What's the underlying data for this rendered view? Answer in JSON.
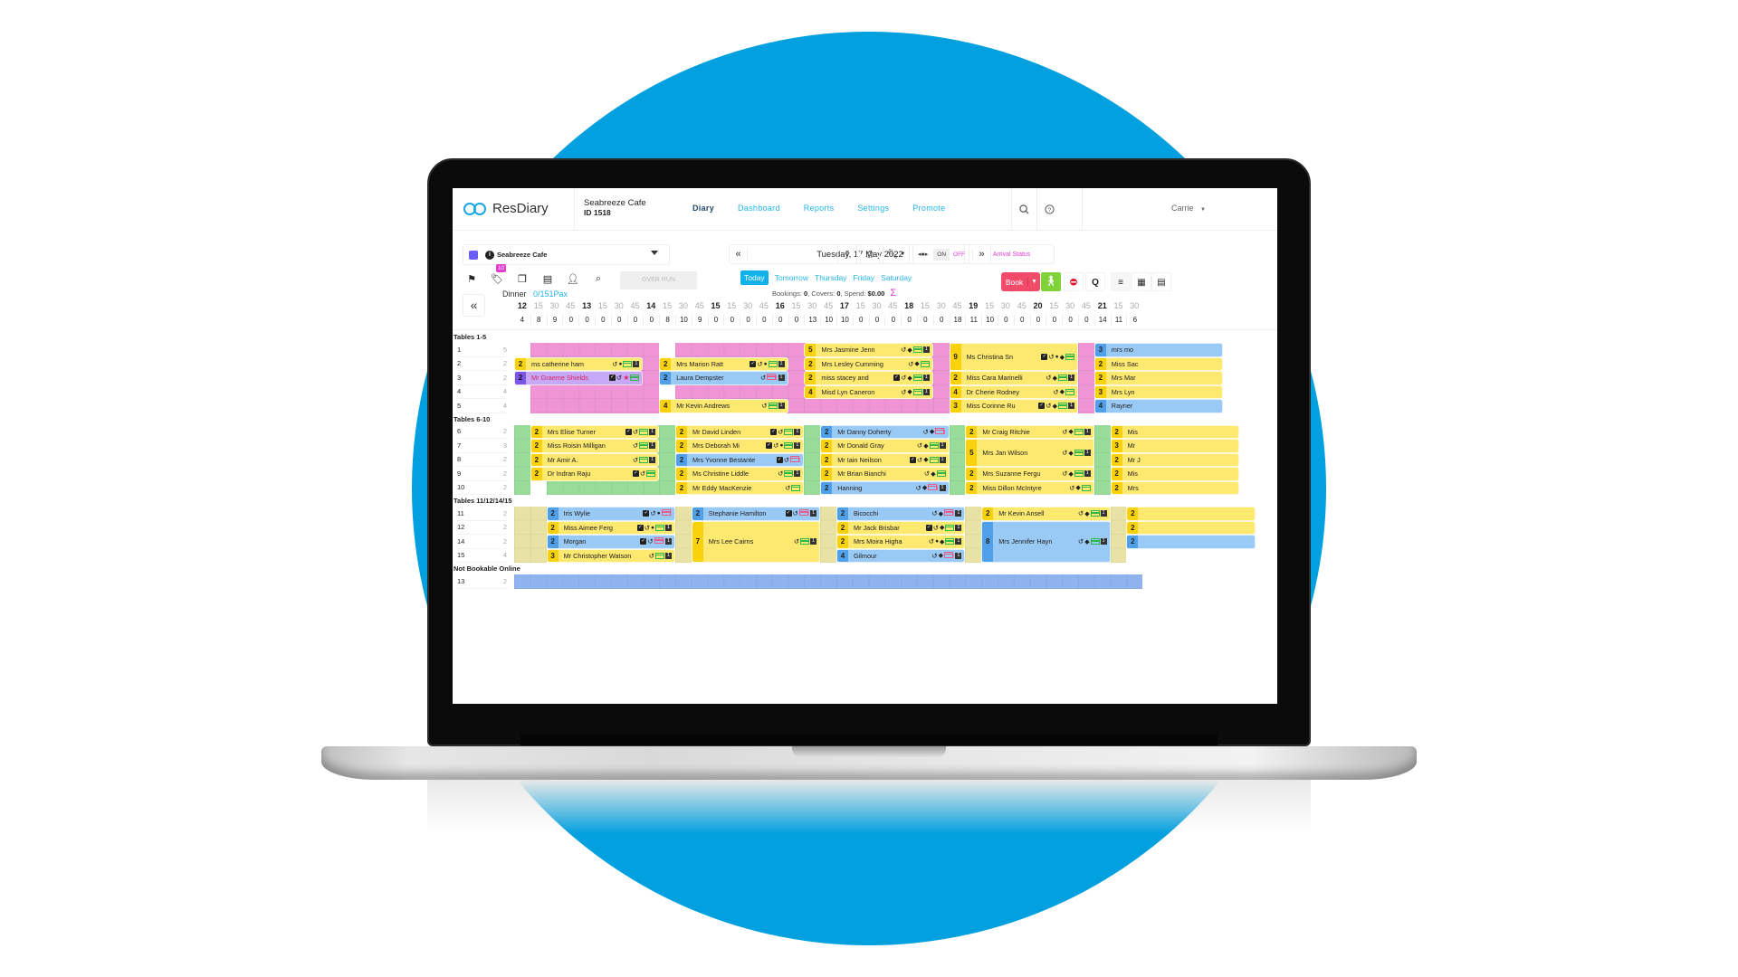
{
  "app": {
    "brand": "ResDiary",
    "venue_name": "Seabreeze Cafe",
    "venue_id": "ID 1518",
    "nav": [
      {
        "label": "Diary",
        "active": true
      },
      {
        "label": "Dashboard",
        "active": false
      },
      {
        "label": "Reports",
        "active": false
      },
      {
        "label": "Settings",
        "active": false
      },
      {
        "label": "Promote",
        "active": false
      }
    ],
    "user": "Carrie"
  },
  "toolbar": {
    "venue_select": "Seabreeze Cafe",
    "tags_badge": "10",
    "overrun_label": "OVER RUN",
    "date": "Tuesday, 17 May 2022",
    "quick_days": [
      "Today",
      "Tomorrow",
      "Thursday",
      "Friday",
      "Saturday"
    ],
    "summary": {
      "bookings_label": "Bookings:",
      "bookings": "0",
      "covers_label": "Covers:",
      "covers": "0",
      "spend_label": "Spend:",
      "spend": "$0.00"
    },
    "toggle_on": "ON",
    "toggle_off": "OFF",
    "arrival_status": "Arrival Status",
    "book_label": "Book",
    "q_label": "Q"
  },
  "service": {
    "name": "Dinner",
    "pax": "0/151Pax",
    "times": [
      "12",
      "15",
      "30",
      "45",
      "13",
      "15",
      "30",
      "45",
      "14",
      "15",
      "30",
      "45",
      "15",
      "15",
      "30",
      "45",
      "16",
      "15",
      "30",
      "45",
      "17",
      "15",
      "30",
      "45",
      "18",
      "15",
      "30",
      "45",
      "19",
      "15",
      "30",
      "45",
      "20",
      "15",
      "30",
      "45",
      "21",
      "15",
      "30"
    ],
    "counts": [
      "4",
      "8",
      "9",
      "0",
      "0",
      "0",
      "0",
      "0",
      "0",
      "8",
      "10",
      "9",
      "0",
      "0",
      "0",
      "0",
      "0",
      "0",
      "13",
      "10",
      "10",
      "0",
      "0",
      "0",
      "0",
      "0",
      "0",
      "18",
      "11",
      "10",
      "0",
      "0",
      "0",
      "0",
      "0",
      "0",
      "14",
      "11",
      "6"
    ]
  },
  "groups": [
    {
      "title": "Tables 1-5",
      "tables": [
        {
          "num": "1",
          "cap": "5"
        },
        {
          "num": "2",
          "cap": "2"
        },
        {
          "num": "3",
          "cap": "2"
        },
        {
          "num": "4",
          "cap": "4"
        },
        {
          "num": "5",
          "cap": "4"
        }
      ],
      "bookings": [
        {
          "row": 1,
          "start": 0,
          "span": 8,
          "rows": 1,
          "covers": "2",
          "name": "ms catherine ham",
          "color": "y",
          "icons": [
            "hist",
            "chat",
            "card",
            "one"
          ]
        },
        {
          "row": 2,
          "start": 0,
          "span": 8,
          "rows": 1,
          "covers": "2",
          "name": "Mr Graeme Shields",
          "color": "p",
          "icons": [
            "chk",
            "hist",
            "star",
            "card"
          ]
        },
        {
          "row": 1,
          "start": 9,
          "span": 8,
          "rows": 1,
          "covers": "2",
          "name": "Mrs Marion Ratt",
          "color": "y",
          "icons": [
            "chk",
            "hist",
            "chat",
            "card",
            "one"
          ]
        },
        {
          "row": 2,
          "start": 9,
          "span": 8,
          "rows": 1,
          "covers": "2",
          "name": "Laura Dempster",
          "color": "b",
          "icons": [
            "hist",
            "badcard",
            "one"
          ]
        },
        {
          "row": 4,
          "start": 9,
          "span": 8,
          "rows": 1,
          "covers": "4",
          "name": "Mr Kevin Andrews",
          "color": "y",
          "icons": [
            "hist",
            "card",
            "one"
          ]
        },
        {
          "row": 0,
          "start": 18,
          "span": 8,
          "rows": 1,
          "covers": "5",
          "name": "Mrs Jasmine Jenn",
          "color": "y",
          "icons": [
            "hist",
            "tag",
            "card",
            "one"
          ]
        },
        {
          "row": 1,
          "start": 18,
          "span": 8,
          "rows": 1,
          "covers": "2",
          "name": "Mrs Lesley Cumming",
          "color": "y",
          "icons": [
            "hist",
            "tag",
            "card"
          ]
        },
        {
          "row": 2,
          "start": 18,
          "span": 8,
          "rows": 1,
          "covers": "2",
          "name": "miss stacey and",
          "color": "y",
          "icons": [
            "chk",
            "hist",
            "tag",
            "card",
            "one"
          ]
        },
        {
          "row": 3,
          "start": 18,
          "span": 8,
          "rows": 1,
          "covers": "4",
          "name": "Misd Lyn Caneron",
          "color": "y",
          "icons": [
            "hist",
            "tag",
            "card",
            "one"
          ]
        },
        {
          "row": 0,
          "start": 27,
          "span": 8,
          "rows": 2,
          "covers": "9",
          "name": "Ms Christina Sn",
          "color": "y",
          "icons": [
            "chk",
            "hist",
            "chat",
            "tag",
            "card"
          ]
        },
        {
          "row": 2,
          "start": 27,
          "span": 8,
          "rows": 1,
          "covers": "2",
          "name": "Miss Cara Marinelli",
          "color": "y",
          "icons": [
            "hist",
            "tag",
            "card",
            "one"
          ]
        },
        {
          "row": 3,
          "start": 27,
          "span": 8,
          "rows": 1,
          "covers": "4",
          "name": "Dr Cherie Rodney",
          "color": "y",
          "icons": [
            "hist",
            "tag",
            "card"
          ]
        },
        {
          "row": 4,
          "start": 27,
          "span": 8,
          "rows": 1,
          "covers": "3",
          "name": "Miss Corinne Ru",
          "color": "y",
          "icons": [
            "chk",
            "hist",
            "tag",
            "card",
            "one"
          ]
        },
        {
          "row": 0,
          "start": 36,
          "span": 8,
          "rows": 1,
          "covers": "3",
          "name": "mrs mo",
          "color": "b",
          "icons": []
        },
        {
          "row": 1,
          "start": 36,
          "span": 8,
          "rows": 1,
          "covers": "2",
          "name": "Miss Sac",
          "color": "y",
          "icons": []
        },
        {
          "row": 2,
          "start": 36,
          "span": 8,
          "rows": 1,
          "covers": "2",
          "name": "Mrs Mar",
          "color": "y",
          "icons": []
        },
        {
          "row": 3,
          "start": 36,
          "span": 8,
          "rows": 1,
          "covers": "3",
          "name": "Mrs Lyn",
          "color": "y",
          "icons": []
        },
        {
          "row": 4,
          "start": 36,
          "span": 8,
          "rows": 1,
          "covers": "4",
          "name": "Rayner",
          "color": "b",
          "icons": []
        }
      ]
    },
    {
      "title": "Tables 6-10",
      "tables": [
        {
          "num": "6",
          "cap": "2"
        },
        {
          "num": "7",
          "cap": "3"
        },
        {
          "num": "8",
          "cap": "2"
        },
        {
          "num": "9",
          "cap": "2"
        },
        {
          "num": "10",
          "cap": "2"
        }
      ],
      "bookings": [
        {
          "row": 0,
          "start": 1,
          "span": 8,
          "rows": 1,
          "covers": "2",
          "name": "Mrs Elise Turner",
          "color": "y",
          "icons": [
            "chk",
            "hist",
            "card",
            "one"
          ]
        },
        {
          "row": 1,
          "start": 1,
          "span": 8,
          "rows": 1,
          "covers": "2",
          "name": "Miss Roisin Milligan",
          "color": "y",
          "icons": [
            "hist",
            "card",
            "one"
          ]
        },
        {
          "row": 2,
          "start": 1,
          "span": 8,
          "rows": 1,
          "covers": "2",
          "name": "Mr Amir A.",
          "color": "y",
          "icons": [
            "hist",
            "card",
            "one"
          ]
        },
        {
          "row": 3,
          "start": 1,
          "span": 8,
          "rows": 1,
          "covers": "2",
          "name": "Dr Indran Raju",
          "color": "y",
          "icons": [
            "chk",
            "hist",
            "card"
          ]
        },
        {
          "row": 0,
          "start": 10,
          "span": 8,
          "rows": 1,
          "covers": "2",
          "name": "Mr David Linden",
          "color": "y",
          "icons": [
            "chk",
            "hist",
            "card",
            "one"
          ]
        },
        {
          "row": 1,
          "start": 10,
          "span": 8,
          "rows": 1,
          "covers": "2",
          "name": "Mrs Deborah Mi",
          "color": "y",
          "icons": [
            "chk",
            "hist",
            "chat",
            "card",
            "one"
          ]
        },
        {
          "row": 2,
          "start": 10,
          "span": 8,
          "rows": 1,
          "covers": "2",
          "name": "Mrs Yvonne Bestante",
          "color": "b",
          "icons": [
            "chk",
            "hist",
            "badcard"
          ]
        },
        {
          "row": 3,
          "start": 10,
          "span": 8,
          "rows": 1,
          "covers": "2",
          "name": "Ms Christine Liddle",
          "color": "y",
          "icons": [
            "hist",
            "card",
            "one"
          ]
        },
        {
          "row": 4,
          "start": 10,
          "span": 8,
          "rows": 1,
          "covers": "2",
          "name": "Mr Eddy MacKenzie",
          "color": "y",
          "icons": [
            "hist",
            "card"
          ]
        },
        {
          "row": 0,
          "start": 19,
          "span": 8,
          "rows": 1,
          "covers": "2",
          "name": "Mr Danny Doherty",
          "color": "b",
          "icons": [
            "hist",
            "tag",
            "badcard"
          ]
        },
        {
          "row": 1,
          "start": 19,
          "span": 8,
          "rows": 1,
          "covers": "2",
          "name": "Mr Donald Gray",
          "color": "y",
          "icons": [
            "hist",
            "tag",
            "card",
            "one"
          ]
        },
        {
          "row": 2,
          "start": 19,
          "span": 8,
          "rows": 1,
          "covers": "2",
          "name": "Mr Iain Neilson",
          "color": "y",
          "icons": [
            "chk",
            "hist",
            "tag",
            "card",
            "one"
          ]
        },
        {
          "row": 3,
          "start": 19,
          "span": 8,
          "rows": 1,
          "covers": "2",
          "name": "Mr Brian Bianchi",
          "color": "y",
          "icons": [
            "hist",
            "tag",
            "card"
          ]
        },
        {
          "row": 4,
          "start": 19,
          "span": 8,
          "rows": 1,
          "covers": "2",
          "name": "Hanning",
          "color": "b",
          "icons": [
            "hist",
            "tag",
            "badcard",
            "one"
          ]
        },
        {
          "row": 0,
          "start": 28,
          "span": 8,
          "rows": 1,
          "covers": "2",
          "name": "Mr Craig Ritchie",
          "color": "y",
          "icons": [
            "hist",
            "tag",
            "card",
            "one"
          ]
        },
        {
          "row": 1,
          "start": 28,
          "span": 8,
          "rows": 2,
          "covers": "5",
          "name": "Mrs Jan Wilson",
          "color": "y",
          "icons": [
            "hist",
            "tag",
            "card",
            "one"
          ]
        },
        {
          "row": 3,
          "start": 28,
          "span": 8,
          "rows": 1,
          "covers": "2",
          "name": "Mrs Suzanne Fergu",
          "color": "y",
          "icons": [
            "hist",
            "tag",
            "card",
            "one"
          ]
        },
        {
          "row": 4,
          "start": 28,
          "span": 8,
          "rows": 1,
          "covers": "2",
          "name": "Miss Dillon McIntyre",
          "color": "y",
          "icons": [
            "hist",
            "tag",
            "card"
          ]
        },
        {
          "row": 0,
          "start": 37,
          "span": 8,
          "rows": 1,
          "covers": "2",
          "name": "Mis",
          "color": "y",
          "icons": []
        },
        {
          "row": 1,
          "start": 37,
          "span": 8,
          "rows": 1,
          "covers": "3",
          "name": "Mr",
          "color": "y",
          "icons": []
        },
        {
          "row": 2,
          "start": 37,
          "span": 8,
          "rows": 1,
          "covers": "2",
          "name": "Mr J",
          "color": "y",
          "icons": []
        },
        {
          "row": 3,
          "start": 37,
          "span": 8,
          "rows": 1,
          "covers": "2",
          "name": "Mis",
          "color": "y",
          "icons": []
        },
        {
          "row": 4,
          "start": 37,
          "span": 8,
          "rows": 1,
          "covers": "2",
          "name": "Mrs",
          "color": "y",
          "icons": []
        }
      ]
    },
    {
      "title": "Tables 11/12/14/15",
      "tables": [
        {
          "num": "11",
          "cap": "2"
        },
        {
          "num": "12",
          "cap": "2"
        },
        {
          "num": "14",
          "cap": "2"
        },
        {
          "num": "15",
          "cap": "4"
        }
      ],
      "bookings": [
        {
          "row": 0,
          "start": 2,
          "span": 8,
          "rows": 1,
          "covers": "2",
          "name": "Iris Wylie",
          "color": "b",
          "icons": [
            "chk",
            "hist",
            "chat",
            "badcard"
          ]
        },
        {
          "row": 1,
          "start": 2,
          "span": 8,
          "rows": 1,
          "covers": "2",
          "name": "Miss Aimee Ferg",
          "color": "y",
          "icons": [
            "chk",
            "hist",
            "chat",
            "card",
            "one"
          ]
        },
        {
          "row": 2,
          "start": 2,
          "span": 8,
          "rows": 1,
          "covers": "2",
          "name": "Morgan",
          "color": "b",
          "icons": [
            "chk",
            "hist",
            "badcard",
            "one"
          ]
        },
        {
          "row": 3,
          "start": 2,
          "span": 8,
          "rows": 1,
          "covers": "3",
          "name": "Mr Christopher Watson",
          "color": "y",
          "icons": [
            "hist",
            "card",
            "one"
          ]
        },
        {
          "row": 0,
          "start": 11,
          "span": 8,
          "rows": 1,
          "covers": "2",
          "name": "Stephanie Hamilton",
          "color": "b",
          "icons": [
            "chk",
            "hist",
            "badcard",
            "one"
          ]
        },
        {
          "row": 1,
          "start": 11,
          "span": 8,
          "rows": 3,
          "covers": "7",
          "name": "Mrs Lee Cairns",
          "color": "y",
          "icons": [
            "hist",
            "card",
            "one"
          ]
        },
        {
          "row": 0,
          "start": 20,
          "span": 8,
          "rows": 1,
          "covers": "2",
          "name": "Bicocchi",
          "color": "b",
          "icons": [
            "hist",
            "tag",
            "badcard",
            "one"
          ]
        },
        {
          "row": 1,
          "start": 20,
          "span": 8,
          "rows": 1,
          "covers": "2",
          "name": "Mr Jack Brisbar",
          "color": "y",
          "icons": [
            "chk",
            "hist",
            "tag",
            "card",
            "one"
          ]
        },
        {
          "row": 2,
          "start": 20,
          "span": 8,
          "rows": 1,
          "covers": "2",
          "name": "Mrs Moira Higha",
          "color": "y",
          "icons": [
            "hist",
            "chat",
            "tag",
            "card",
            "one"
          ]
        },
        {
          "row": 3,
          "start": 20,
          "span": 8,
          "rows": 1,
          "covers": "4",
          "name": "Gilmour",
          "color": "b",
          "icons": [
            "hist",
            "tag",
            "badcard",
            "one"
          ]
        },
        {
          "row": 0,
          "start": 29,
          "span": 8,
          "rows": 1,
          "covers": "2",
          "name": "Mr Kevin Ansell",
          "color": "y",
          "icons": [
            "hist",
            "tag",
            "card",
            "one"
          ]
        },
        {
          "row": 1,
          "start": 29,
          "span": 8,
          "rows": 3,
          "covers": "8",
          "name": "Mrs Jennifer Hayn",
          "color": "b",
          "icons": [
            "hist",
            "tag",
            "card",
            "one"
          ]
        },
        {
          "row": 0,
          "start": 38,
          "span": 8,
          "rows": 1,
          "covers": "2",
          "name": "",
          "color": "y",
          "icons": []
        },
        {
          "row": 1,
          "start": 38,
          "span": 8,
          "rows": 1,
          "covers": "2",
          "name": "",
          "color": "y",
          "icons": []
        },
        {
          "row": 2,
          "start": 38,
          "span": 8,
          "rows": 1,
          "covers": "2",
          "name": "",
          "color": "b",
          "icons": []
        }
      ]
    },
    {
      "title": "Not Bookable Online",
      "tables": [
        {
          "num": "13",
          "cap": "2"
        }
      ],
      "bookings": []
    }
  ],
  "colors": {
    "brand": "#1aa7e6",
    "circle": "#02a0de",
    "booking_yellow": "#fde870",
    "booking_blue": "#99c9f5",
    "booking_purple": "#c7a8f6",
    "area_pink": "#ef95d6",
    "area_green": "#98dc9a",
    "area_beige": "#e8e3a4",
    "area_blue": "#8fb3ee",
    "book_button": "#f24b6a",
    "walkin_button": "#7fd23a",
    "accent_magenta": "#e53ad2"
  }
}
